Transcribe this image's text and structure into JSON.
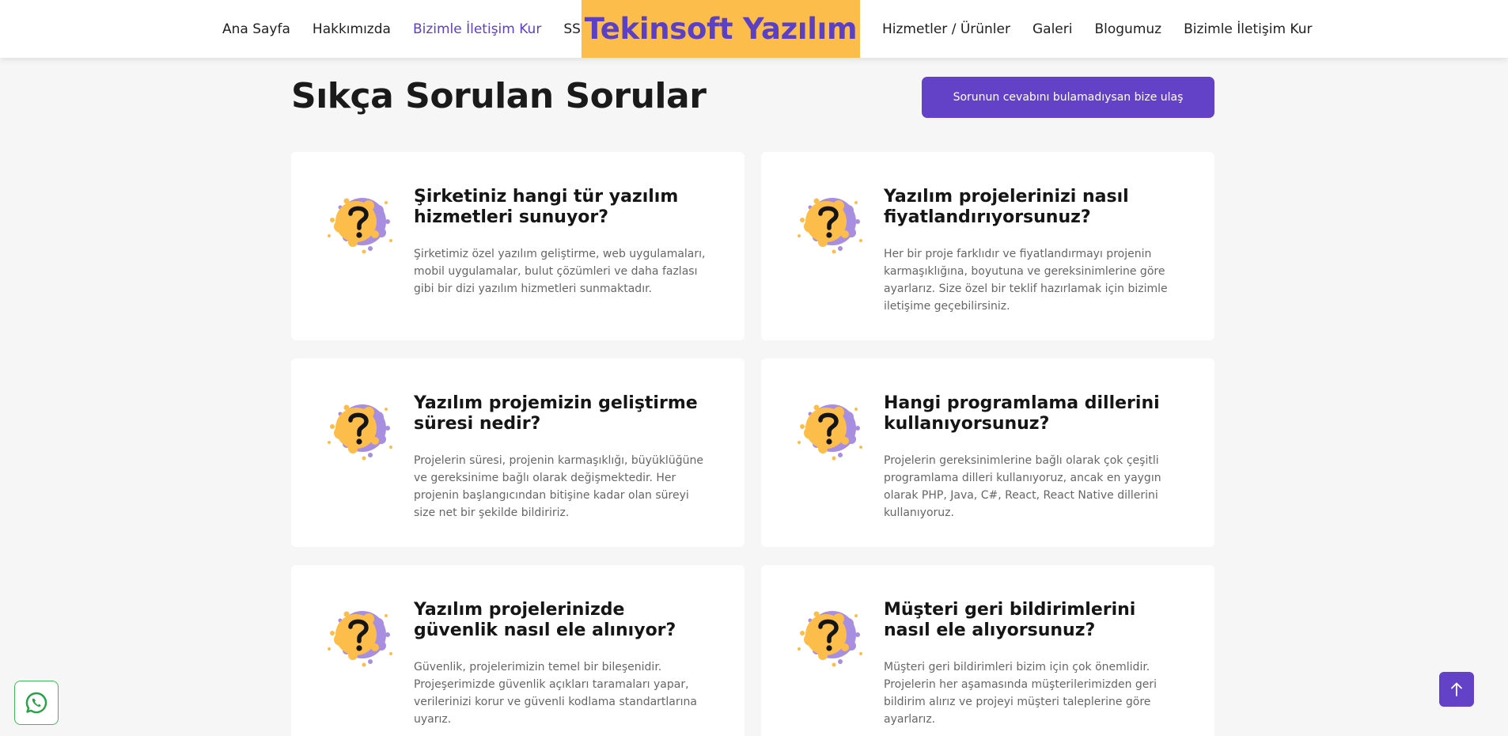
{
  "nav": {
    "left_items": [
      "Ana Sayfa",
      "Hakkımızda",
      "Bizimle İletişim Kur",
      "SSS"
    ],
    "brand": "Tekinsoft Yazılım",
    "right_items": [
      "Hizmetler / Ürünler",
      "Galeri",
      "Blogumuz",
      "Bizimle İletişim Kur"
    ],
    "active_label": "Bizimle İletişim Kur"
  },
  "page": {
    "title": "Sıkça Sorulan Sorular",
    "contact_button": "Sorunun cevabını bulamadıysan bize ulaş"
  },
  "faqs": [
    {
      "question": "Şirketiniz hangi tür yazılım hizmetleri sunuyor?",
      "answer": "Şirketimiz özel yazılım geliştirme, web uygulamaları, mobil uygulamalar, bulut çözümleri ve daha fazlası gibi bir dizi yazılım hizmetleri sunmaktadır."
    },
    {
      "question": "Yazılım projelerinizi nasıl fiyatlandırıyorsunuz?",
      "answer": "Her bir proje farklıdır ve fiyatlandırmayı projenin karmaşıklığına, boyutuna ve gereksinimlerine göre ayarlarız. Size özel bir teklif hazırlamak için bizimle iletişime geçebilirsiniz."
    },
    {
      "question": "Yazılım projemizin geliştirme süresi nedir?",
      "answer": "Projelerin süresi, projenin karmaşıklığı, büyüklüğüne ve gereksinime bağlı olarak değişmektedir. Her projenin başlangıcından bitişine kadar olan süreyi size net bir şekilde bildiririz."
    },
    {
      "question": "Hangi programlama dillerini kullanıyorsunuz?",
      "answer": "Projelerin gereksinimlerine bağlı olarak çok çeşitli programlama dilleri kullanıyoruz, ancak en yaygın olarak PHP, Java, C#, React, React Native dillerini kullanıyoruz."
    },
    {
      "question": "Yazılım projelerinizde güvenlik nasıl ele alınıyor?",
      "answer": "Güvenlik, projelerimizin temel bir bileşenidir. Projeşerimizde güvenlik açıkları taramaları yapar, verilerinizi korur ve güvenli kodlama standartlarına uyarız."
    },
    {
      "question": "Müşteri geri bildirimlerini nasıl ele alıyorsunuz?",
      "answer": "Müşteri geri bildirimleri bizim için çok önemlidir. Projelerin her aşamasında müşterilerimizden geri bildirim alırız ve projeyi müşteri taleplerine göre ayarlarız."
    }
  ],
  "colors": {
    "accent": "#6442c8",
    "brand_bg": "#fdbd4a",
    "whatsapp": "#25a244"
  },
  "icons": {
    "faq": "question-splash-icon",
    "whatsapp": "whatsapp-icon",
    "scroll_top": "arrow-up-icon"
  }
}
